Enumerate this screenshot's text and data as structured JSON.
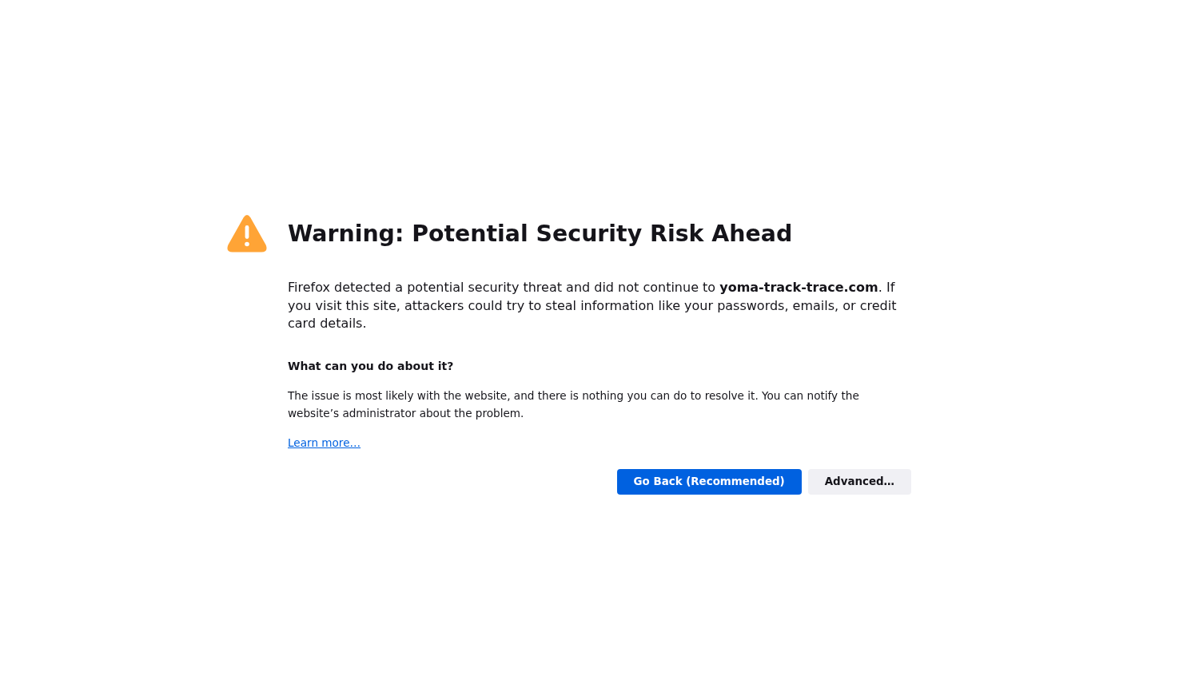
{
  "title": "Warning: Potential Security Risk Ahead",
  "intro": "Firefox detected a potential security threat and did not continue to **yoma-track-trace.com**. If you visit this site, attackers could try to steal information like your passwords, emails, or credit card details.",
  "section": {
    "heading": "What can you do about it?",
    "text": "The issue is most likely with the website, and there is nothing you can do to resolve it. You can notify the website’s administrator about the problem."
  },
  "learn_more_link": "Learn more…",
  "buttons": [
    {
      "label": "Go Back (Recommended)",
      "kind": "primary"
    },
    {
      "label": "Advanced…",
      "kind": "secondary"
    }
  ]
}
